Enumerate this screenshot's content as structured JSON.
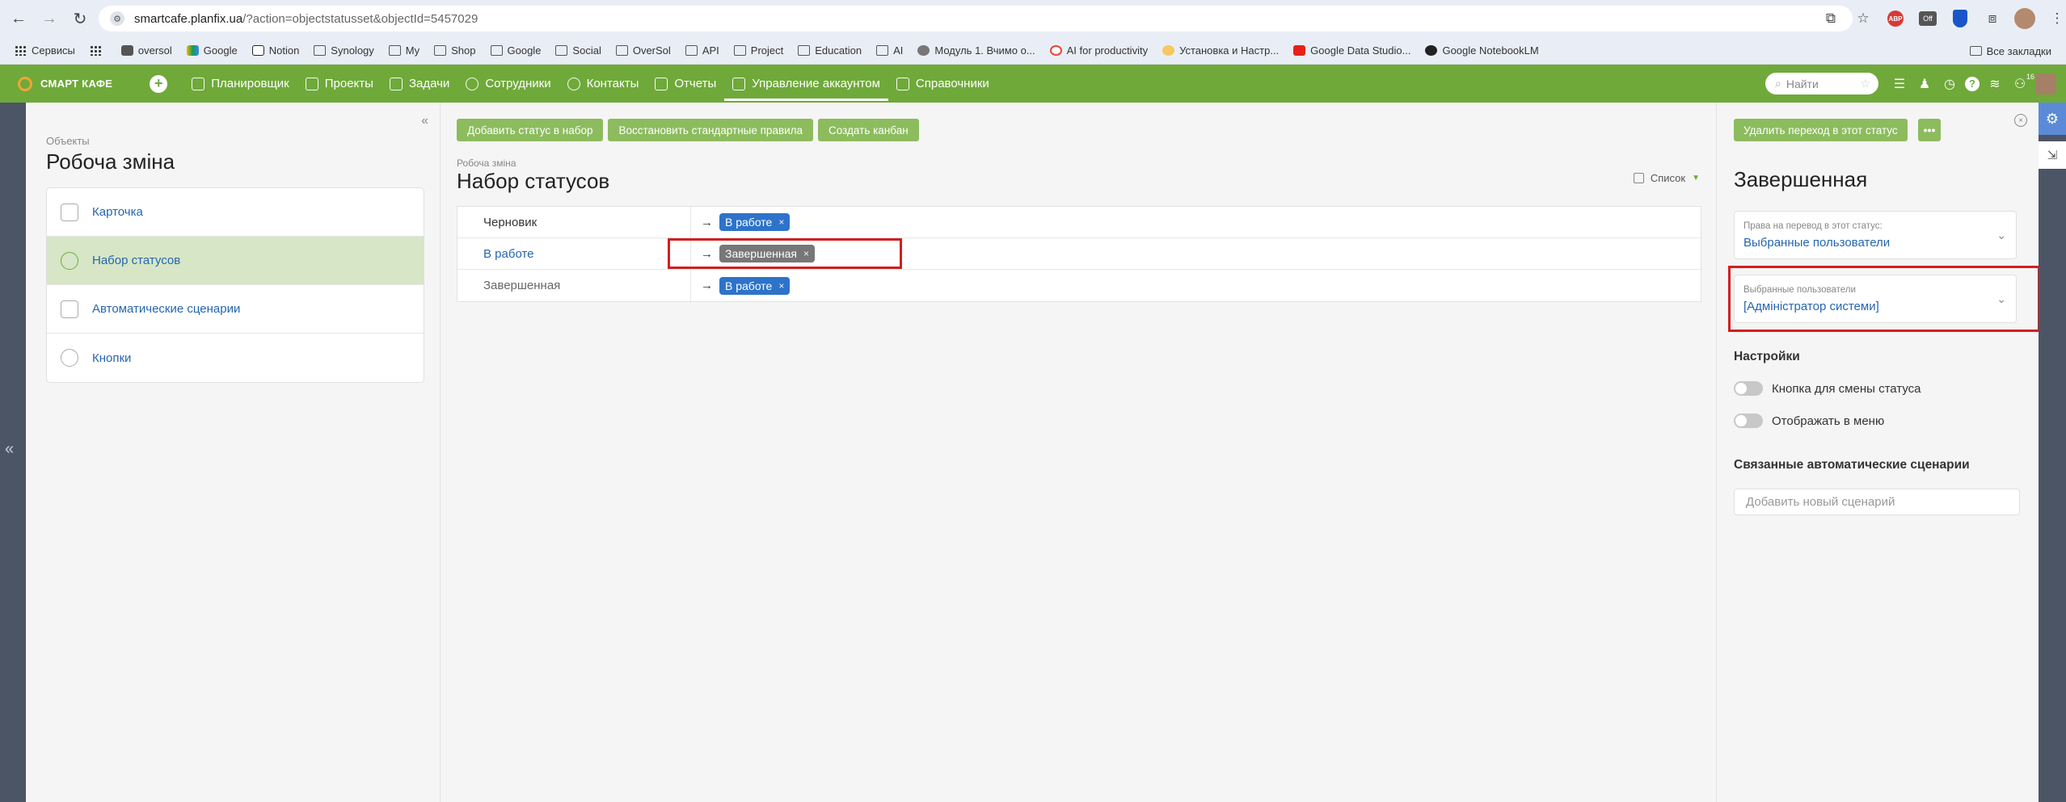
{
  "browser": {
    "url_host": "smartcafe.planfix.ua",
    "url_rest": "/?action=objectstatusset&objectId=5457029"
  },
  "bookmarks": [
    {
      "label": "Сервисы",
      "icon": "apps-grid-icon"
    },
    {
      "label": "",
      "icon": "grid-icon"
    },
    {
      "label": "oversol",
      "icon": "site-icon"
    },
    {
      "label": "Google",
      "icon": "google-drive-icon"
    },
    {
      "label": "Notion",
      "icon": "notion-icon"
    },
    {
      "label": "Synology",
      "icon": "folder-icon"
    },
    {
      "label": "My",
      "icon": "folder-icon"
    },
    {
      "label": "Shop",
      "icon": "folder-icon"
    },
    {
      "label": "Google",
      "icon": "folder-icon"
    },
    {
      "label": "Social",
      "icon": "folder-icon"
    },
    {
      "label": "OverSol",
      "icon": "folder-icon"
    },
    {
      "label": "API",
      "icon": "folder-icon"
    },
    {
      "label": "Project",
      "icon": "folder-icon"
    },
    {
      "label": "Education",
      "icon": "folder-icon"
    },
    {
      "label": "AI",
      "icon": "folder-icon"
    },
    {
      "label": "Модуль 1. Вчимо о...",
      "icon": "site-icon"
    },
    {
      "label": "AI for productivity",
      "icon": "google-icon"
    },
    {
      "label": "Установка и Настр...",
      "icon": "site-icon"
    },
    {
      "label": "Google Data Studio...",
      "icon": "youtube-icon"
    },
    {
      "label": "Google NotebookLM",
      "icon": "notebooklm-icon"
    }
  ],
  "bookmarks_right": "Все закладки",
  "header": {
    "logo": "СМАРТ КАФЕ",
    "nav": [
      {
        "label": "Планировщик",
        "icon": "planner-icon"
      },
      {
        "label": "Проекты",
        "icon": "projects-icon"
      },
      {
        "label": "Задачи",
        "icon": "tasks-icon"
      },
      {
        "label": "Сотрудники",
        "icon": "employees-icon"
      },
      {
        "label": "Контакты",
        "icon": "contacts-icon"
      },
      {
        "label": "Отчеты",
        "icon": "reports-icon"
      },
      {
        "label": "Управление аккаунтом",
        "icon": "account-icon",
        "active": true
      },
      {
        "label": "Справочники",
        "icon": "directories-icon"
      }
    ],
    "search_placeholder": "Найти",
    "notification_count": "16"
  },
  "sidebar": {
    "crumb": "Объекты",
    "title": "Робоча зміна",
    "items": [
      {
        "label": "Карточка",
        "icon": "card-icon"
      },
      {
        "label": "Набор статусов",
        "icon": "status-set-icon",
        "active": true
      },
      {
        "label": "Автоматические сценарии",
        "icon": "scenario-icon"
      },
      {
        "label": "Кнопки",
        "icon": "buttons-icon"
      }
    ]
  },
  "main": {
    "toolbar": [
      "Добавить статус в набор",
      "Восстановить стандартные правила",
      "Создать канбан"
    ],
    "crumb": "Робоча зміна",
    "title": "Набор статусов",
    "view": "Список",
    "rows": [
      {
        "name": "Черновик",
        "transition": "В работе"
      },
      {
        "name": "В работе",
        "transition": "Завершенная"
      },
      {
        "name": "Завершенная",
        "transition": "В работе"
      }
    ]
  },
  "right_panel": {
    "delete_button": "Удалить переход в этот статус",
    "title": "Завершенная",
    "rights_label": "Права на перевод в этот статус:",
    "rights_value": "Выбранные пользователи",
    "users_label": "Выбранные пользователи",
    "users_value": "[Адміністратор системи]",
    "settings_title": "Настройки",
    "toggle1": "Кнопка для смены статуса",
    "toggle2": "Отображать в меню",
    "scenarios_title": "Связанные автоматические сценарии",
    "scenario_placeholder": "Добавить новый сценарий"
  },
  "colors": {
    "header_green": "#6fa93a",
    "button_green": "#8cbc5e",
    "chip_blue": "#2d73c9",
    "link_blue": "#2566b0",
    "highlight_red": "#d21f1f"
  }
}
